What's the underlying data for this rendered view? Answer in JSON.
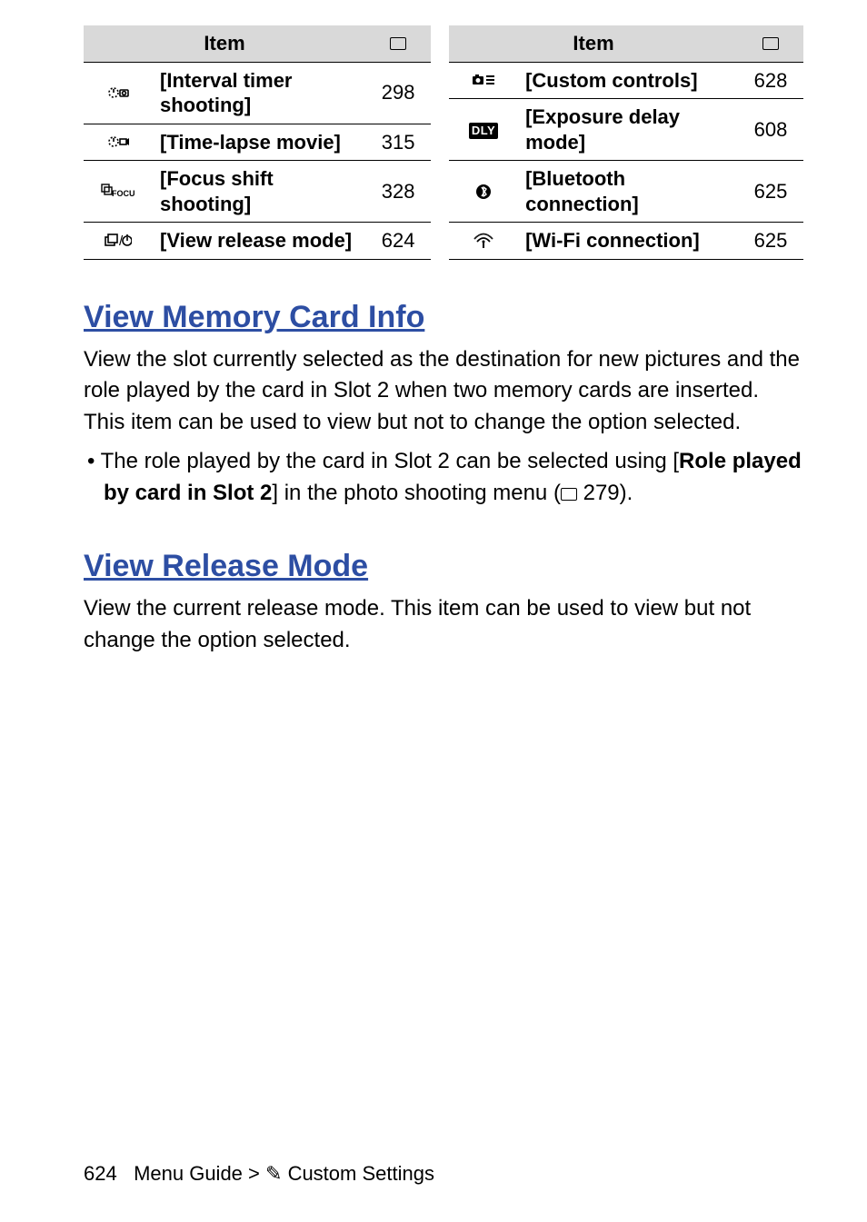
{
  "tables": {
    "left": {
      "header": "Item",
      "rows": [
        {
          "name": "[Interval timer shooting]",
          "page": "298"
        },
        {
          "name": "[Time-lapse movie]",
          "page": "315"
        },
        {
          "name": "[Focus shift shooting]",
          "page": "328"
        },
        {
          "name": "[View release mode]",
          "page": "624"
        }
      ]
    },
    "right": {
      "header": "Item",
      "rows": [
        {
          "name": "[Custom controls]",
          "page": "628"
        },
        {
          "name": "[Exposure delay mode]",
          "page": "608"
        },
        {
          "name": "[Bluetooth connection]",
          "page": "625"
        },
        {
          "name": "[Wi-Fi connection]",
          "page": "625"
        }
      ]
    }
  },
  "sections": {
    "mem": {
      "title": "View Memory Card Info",
      "p1": "View the slot currently selected as the destination for new pictures and the role played by the card in Slot 2 when two memory cards are inserted. This item can be used to view but not to change the option selected.",
      "bullet_prefix": "• The role played by the card in Slot 2 can be selected using [",
      "bullet_bold": "Role played by card in Slot 2",
      "bullet_suffix": "] in the photo shooting menu (",
      "bullet_page": " 279)."
    },
    "rel": {
      "title": "View Release Mode",
      "p1": "View the current release mode. This item can be used to view but not change the option selected."
    }
  },
  "footer": {
    "page": "624",
    "crumb_a": "Menu Guide",
    "crumb_b": "Custom Settings"
  },
  "icons": {
    "dly": "DLY",
    "focus": "FOCUS"
  }
}
